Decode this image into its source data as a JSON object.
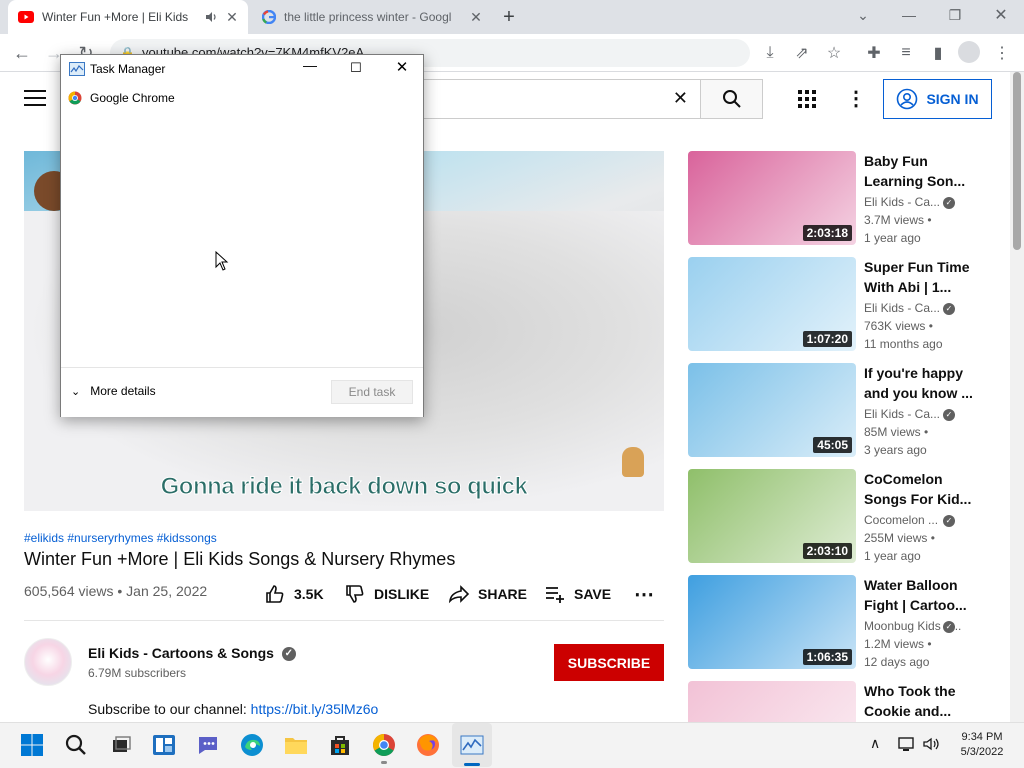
{
  "browser": {
    "tabs": [
      {
        "label": "Winter Fun +More | Eli Kids",
        "active": true
      },
      {
        "label": "the little princess winter - Googl",
        "active": false
      }
    ],
    "new_tab": "+",
    "address": "youtube.com/watch?v=7KM4mfKV2eA"
  },
  "youtube": {
    "signin_label": "SIGN IN",
    "video": {
      "caption": "Gonna ride it back down so quick",
      "hashtags": "#elikids #nurseryrhymes #kidssongs",
      "title": "Winter Fun +More | Eli Kids Songs & Nursery Rhymes",
      "views_date": "605,564 views • Jan 25, 2022",
      "like_count": "3.5K",
      "dislike_label": "DISLIKE",
      "share_label": "SHARE",
      "save_label": "SAVE"
    },
    "channel": {
      "name": "Eli Kids - Cartoons & Songs",
      "subscribers": "6.79M subscribers",
      "subscribe_label": "SUBSCRIBE",
      "desc_prefix": "Subscribe to our channel: ",
      "desc_link": "https://bit.ly/35lMz6o"
    },
    "recommendations": [
      {
        "title": "Baby Fun Learning Son...",
        "channel": "Eli Kids - Ca...",
        "views": "3.7M views •",
        "date": "1 year ago",
        "duration": "2:03:18",
        "color": "#d9639b"
      },
      {
        "title": "Super Fun Time With Abi | 1...",
        "channel": "Eli Kids - Ca...",
        "views": "763K views •",
        "date": "11 months ago",
        "duration": "1:07:20",
        "color": "#9ad0ef"
      },
      {
        "title": "If you're happy and you know ...",
        "channel": "Eli Kids - Ca...",
        "views": "85M views •",
        "date": "3 years ago",
        "duration": "45:05",
        "color": "#7bc0e8"
      },
      {
        "title": "CoComelon Songs For Kid...",
        "channel": "Cocomelon ...",
        "views": "255M views •",
        "date": "1 year ago",
        "duration": "2:03:10",
        "color": "#8fbf6a"
      },
      {
        "title": "Water Balloon Fight | Cartoo...",
        "channel": "Moonbug Kids - ...",
        "views": "1.2M views •",
        "date": "12 days ago",
        "duration": "1:06:35",
        "color": "#3f9fe0"
      },
      {
        "title": "Who Took the Cookie and...",
        "channel": "",
        "views": "",
        "date": "",
        "duration": "",
        "color": "#f2c2d6"
      }
    ]
  },
  "task_manager": {
    "title": "Task Manager",
    "process": "Google Chrome",
    "more_details": "More details",
    "end_task": "End task"
  },
  "taskbar": {
    "time": "9:34 PM",
    "date": "5/3/2022"
  }
}
